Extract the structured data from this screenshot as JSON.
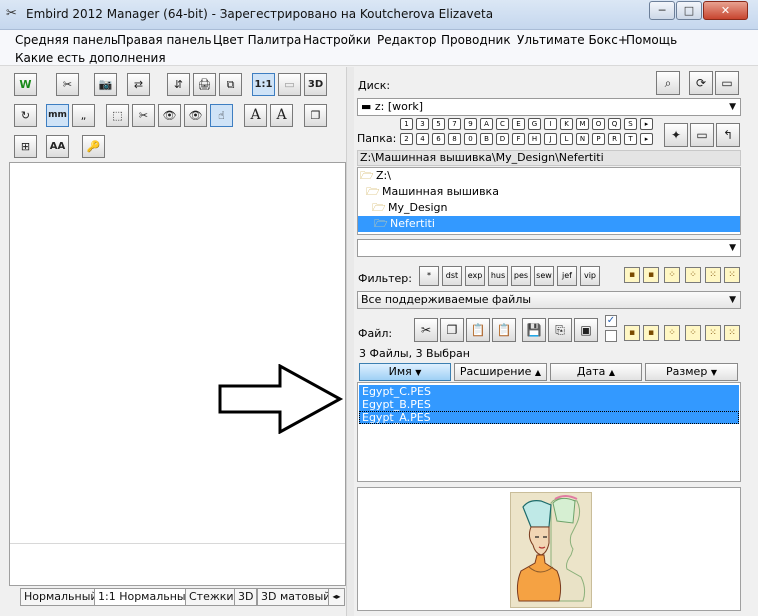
{
  "window": {
    "title": "Embird 2012 Manager (64-bit) - Зарегестрировано на Koutcherova Elizaveta",
    "app_icon": "scissors-icon",
    "minimize": "─",
    "maximize": "□",
    "close": "✕"
  },
  "menu": [
    "Средняя панель",
    "Правая панель",
    "Цвет Палитра",
    "Настройки",
    "Редактор",
    "Проводник",
    "Ультимате Бокс+",
    "Помощь",
    "Какие есть дополнения"
  ],
  "left_toolbar": {
    "row1": [
      "W",
      "✂",
      "📷",
      "⇄",
      "⇵",
      "🖨",
      "⧉",
      "1:1",
      "▭",
      "3D"
    ],
    "row2": [
      "↻",
      "mm",
      "„",
      "⬚",
      "✂",
      "👁",
      "👁",
      "☝",
      "A",
      "A"
    ],
    "row3": [
      "⊞",
      "AA",
      "🔑"
    ],
    "row4_extra": [
      "❐"
    ]
  },
  "view_tabs": [
    "Нормальный",
    "1:1 Нормальный",
    "Стежки",
    "3D",
    "3D матовый"
  ],
  "right_panel": {
    "disk_label": "Диск:",
    "disk_value": "z: [work]",
    "folder_label": "Папка:",
    "letter_keys": [
      "1",
      "3",
      "5",
      "7",
      "9",
      "A",
      "C",
      "E",
      "G",
      "I",
      "K",
      "M",
      "O",
      "Q",
      "S"
    ],
    "number_keys": [
      "2",
      "4",
      "6",
      "8",
      "0",
      "B",
      "D",
      "F",
      "H",
      "J",
      "L",
      "N",
      "P",
      "R",
      "T"
    ],
    "current_path": "Z:\\Машинная вышивка\\My_Design\\Nefertiti",
    "tree": [
      {
        "label": "Z:\\",
        "indent": 0,
        "selected": false
      },
      {
        "label": "Машинная вышивка",
        "indent": 1,
        "selected": false
      },
      {
        "label": "My_Design",
        "indent": 2,
        "selected": false
      },
      {
        "label": "Nefertiti",
        "indent": 3,
        "selected": true
      }
    ],
    "filter_label": "Фильтер:",
    "filter_buttons": [
      "*",
      "dst",
      "exp",
      "hus",
      "pes",
      "sew",
      "jef",
      "vip"
    ],
    "filter_value": "Все поддерживаемые файлы",
    "file_label": "Файл:",
    "status": "3 Файлы, 3 Выбран",
    "columns": [
      {
        "label": "Имя",
        "arrow": "▼"
      },
      {
        "label": "Расширение",
        "arrow": "▲"
      },
      {
        "label": "Дата",
        "arrow": "▲"
      },
      {
        "label": "Размер",
        "arrow": "▼"
      }
    ],
    "files": [
      "Egypt_C.PES",
      "Egypt_B.PES",
      "Egypt_A.PES"
    ],
    "checkbox_checked": "✓"
  }
}
